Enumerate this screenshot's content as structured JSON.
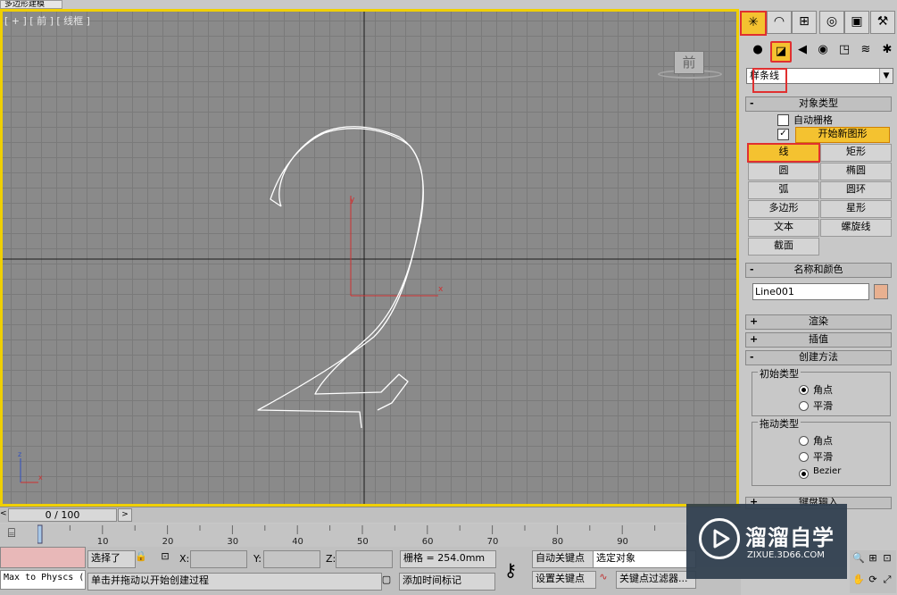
{
  "window": {
    "title_tab": "多边形建模"
  },
  "viewport": {
    "label": "[ + ] [ 前 ] [ 线框 ]",
    "viewcube_face": "前",
    "axis_y": "y",
    "axis_x": "x",
    "corner_axis_z": "z",
    "corner_axis_x": "x"
  },
  "panel": {
    "tabs": [
      {
        "icon": "create-icon",
        "glyph": "✳"
      },
      {
        "icon": "modify-icon",
        "glyph": "◠"
      },
      {
        "icon": "hierarchy-icon",
        "glyph": "⊞"
      },
      {
        "icon": "motion-icon",
        "glyph": "◎"
      },
      {
        "icon": "display-icon",
        "glyph": "▣"
      },
      {
        "icon": "utilities-icon",
        "glyph": "⚒"
      }
    ],
    "categories": [
      {
        "icon": "geometry-icon",
        "glyph": "●"
      },
      {
        "icon": "shapes-icon",
        "glyph": "◪"
      },
      {
        "icon": "lights-icon",
        "glyph": "◀"
      },
      {
        "icon": "cameras-icon",
        "glyph": "◉"
      },
      {
        "icon": "helpers-icon",
        "glyph": "◳"
      },
      {
        "icon": "spacewarps-icon",
        "glyph": "≋"
      },
      {
        "icon": "systems-icon",
        "glyph": "✱"
      }
    ],
    "category_dropdown": "样条线",
    "object_type": {
      "header": "对象类型",
      "auto_grid": "自动栅格",
      "start_new_shape": "开始新图形",
      "buttons": [
        "线",
        "矩形",
        "圆",
        "椭圆",
        "弧",
        "圆环",
        "多边形",
        "星形",
        "文本",
        "螺旋线",
        "截面"
      ]
    },
    "name_color": {
      "header": "名称和颜色",
      "name": "Line001",
      "swatch_color": "#e8b090"
    },
    "render_header": "渲染",
    "interp_header": "插值",
    "creation_method": {
      "header": "创建方法",
      "initial_type": "初始类型",
      "initial_options": [
        "角点",
        "平滑"
      ],
      "drag_type": "拖动类型",
      "drag_options": [
        "角点",
        "平滑",
        "Bezier"
      ]
    },
    "keyboard_entry": "键盘输入"
  },
  "timeline": {
    "frame_display": "0 / 100",
    "ticks": [
      "10",
      "20",
      "30",
      "40",
      "50",
      "60",
      "70",
      "80",
      "90"
    ]
  },
  "status": {
    "script_listener": "Max to Physcs (",
    "selection": "选择了",
    "x_label": "X:",
    "y_label": "Y:",
    "z_label": "Z:",
    "grid": "栅格 = 254.0mm",
    "auto_key": "自动关键点",
    "set_key": "设置关键点",
    "selected_object": "选定对象",
    "key_filters": "关键点过滤器...",
    "prompt": "单击并拖动以开始创建过程",
    "add_time_tag": "添加时间标记",
    "frame_field": "0"
  },
  "watermark": {
    "title": "溜溜自学",
    "url": "ZIXUE.3D66.COM"
  },
  "colors": {
    "active": "#f4c230",
    "highlight_box": "#e03030",
    "viewport_border": "#f0d000"
  }
}
